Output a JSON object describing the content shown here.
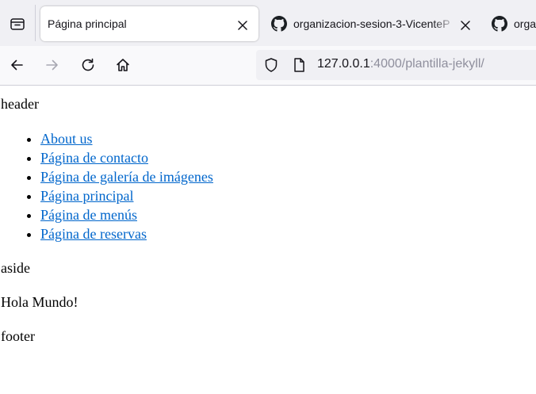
{
  "browser": {
    "tabs": [
      {
        "title": "Página principal",
        "active": true,
        "icon": "page-icon"
      },
      {
        "title": "organizacion-sesion-3-VicenteP",
        "active": false,
        "icon": "github-icon"
      },
      {
        "title": "orga",
        "active": false,
        "icon": "github-icon"
      }
    ],
    "url": {
      "host": "127.0.0.1",
      "rest": ":4000/plantilla-jekyll/"
    }
  },
  "page": {
    "header": "header",
    "nav_links": [
      "About us",
      "Página de contacto",
      "Página de galería de imágenes",
      "Página principal",
      "Página de menús",
      "Página de reservas"
    ],
    "aside": "aside",
    "main_text": "Hola Mundo!",
    "footer": "footer"
  },
  "colors": {
    "link": "#0066cc",
    "tabstrip": "#f0f0f4",
    "navbar": "#f9f9fb"
  }
}
